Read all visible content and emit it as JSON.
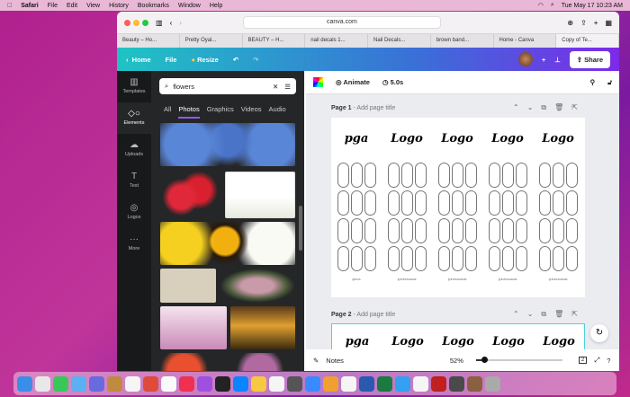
{
  "menubar": {
    "app": "Safari",
    "items": [
      "File",
      "Edit",
      "View",
      "History",
      "Bookmarks",
      "Window",
      "Help"
    ],
    "clock": "Tue May 17  10:23 AM"
  },
  "browser": {
    "url": "canva.com",
    "tabs": [
      "Beauty – Ho...",
      "Pretty Oyal...",
      "BEAUTY – H...",
      "nail decals 1...",
      "Nail Decals...",
      "brown band...",
      "Home - Canva",
      "Copy of Te..."
    ]
  },
  "header": {
    "home": "Home",
    "file": "File",
    "resize": "Resize",
    "share": "Share"
  },
  "sidebar": [
    {
      "icon": "templates-icon",
      "label": "Templates"
    },
    {
      "icon": "elements-icon",
      "label": "Elements"
    },
    {
      "icon": "uploads-icon",
      "label": "Uploads"
    },
    {
      "icon": "text-icon",
      "label": "Text"
    },
    {
      "icon": "logos-icon",
      "label": "Logos"
    },
    {
      "icon": "more-icon",
      "label": "More"
    }
  ],
  "panel": {
    "search_value": "flowers",
    "tabs": [
      "All",
      "Photos",
      "Graphics",
      "Videos",
      "Audio"
    ],
    "active_tab": "Photos"
  },
  "editor": {
    "animate": "Animate",
    "duration": "5.0s"
  },
  "pages": [
    {
      "label": "Page 1",
      "title_placeholder": "- Add page title"
    },
    {
      "label": "Page 2",
      "title_placeholder": "- Add page title"
    }
  ],
  "design": {
    "logos": [
      "pga",
      "Logo",
      "Logo",
      "Logo",
      "Logo"
    ],
    "handles": [
      "@PGA",
      "@INSTAGRAM",
      "@INSTAGRAM",
      "@INSTAGRAM",
      "@INSTAGRAM"
    ]
  },
  "footer": {
    "notes": "Notes",
    "zoom": "52%",
    "zoom_level": 52,
    "page_count": "2"
  }
}
